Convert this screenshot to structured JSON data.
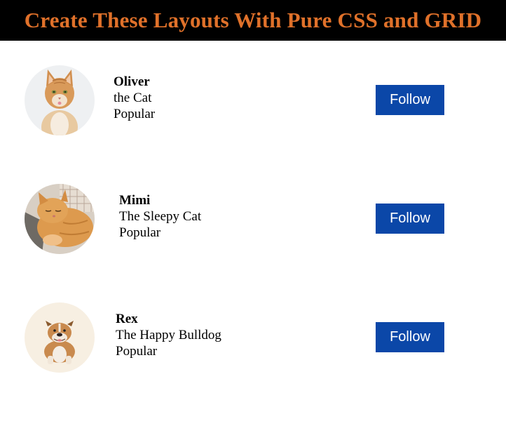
{
  "header": {
    "title": "Create These Layouts With Pure CSS and GRID",
    "title_color": "#e0712a",
    "background": "#000000"
  },
  "cards": [
    {
      "name": "Oliver",
      "description": "the Cat",
      "status": "Popular",
      "avatar_icon": "cat-photo-icon",
      "follow_label": "Follow"
    },
    {
      "name": "Mimi",
      "description": "The Sleepy Cat",
      "status": "Popular",
      "avatar_icon": "sleeping-cat-photo-icon",
      "follow_label": "Follow"
    },
    {
      "name": "Rex",
      "description": "The Happy Bulldog",
      "status": "Popular",
      "avatar_icon": "bulldog-photo-icon",
      "follow_label": "Follow"
    }
  ],
  "colors": {
    "button": "#0b47a8",
    "button_text": "#ffffff"
  }
}
